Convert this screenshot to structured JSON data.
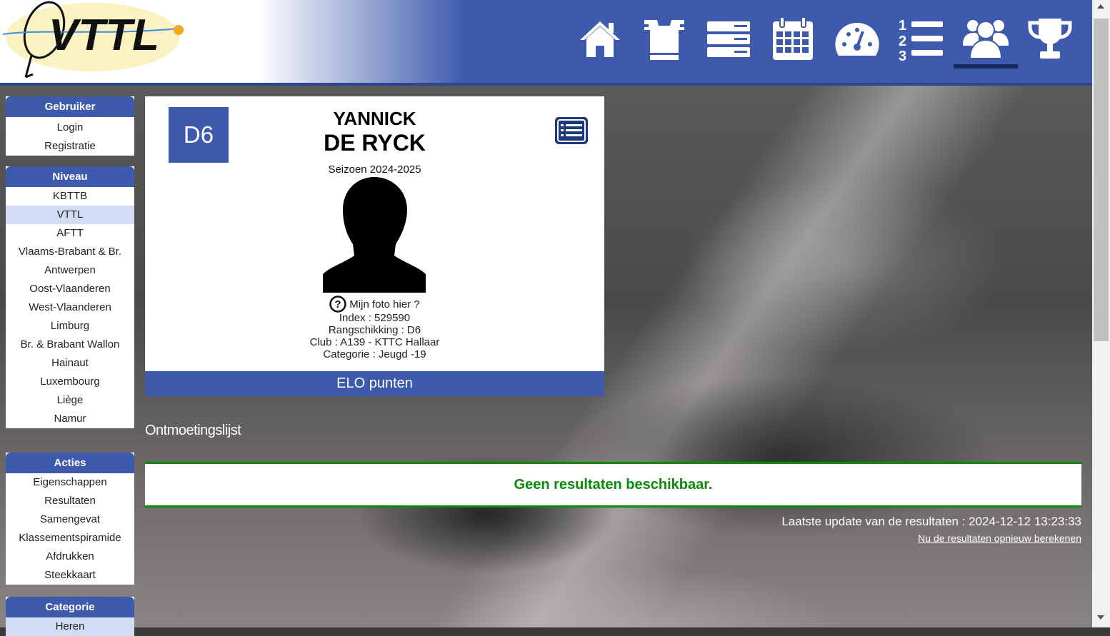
{
  "logo": {
    "text": "VTTL"
  },
  "nav": [
    {
      "icon": "home-icon",
      "active": false
    },
    {
      "icon": "shirt-icon",
      "active": false
    },
    {
      "icon": "divisions-icon",
      "active": false
    },
    {
      "icon": "calendar-icon",
      "active": false
    },
    {
      "icon": "speedometer-icon",
      "active": false
    },
    {
      "icon": "ranking-list-icon",
      "active": false
    },
    {
      "icon": "players-icon",
      "active": true
    },
    {
      "icon": "trophy-icon",
      "active": false
    }
  ],
  "sidebar": {
    "user": {
      "title": "Gebruiker",
      "items": [
        "Login",
        "Registratie"
      ]
    },
    "level": {
      "title": "Niveau",
      "selected": "VTTL",
      "items": [
        "KBTTB",
        "VTTL",
        "AFTT",
        "Vlaams-Brabant & Br.",
        "Antwerpen",
        "Oost-Vlaanderen",
        "West-Vlaanderen",
        "Limburg",
        "Br. & Brabant Wallon",
        "Hainaut",
        "Luxembourg",
        "Liège",
        "Namur"
      ]
    },
    "actions": {
      "title": "Acties",
      "items": [
        "Eigenschappen",
        "Resultaten",
        "Samengevat",
        "Klassementspiramide",
        "Afdrukken",
        "Steekkaart"
      ]
    },
    "category": {
      "title": "Categorie",
      "items": [
        "Heren"
      ]
    }
  },
  "player": {
    "rank_badge": "D6",
    "first_name": "YANNICK",
    "last_name": "DE RYCK",
    "season": "Seizoen 2024-2025",
    "photo_prompt": "Mijn foto hier ?",
    "index": "Index : 529590",
    "ranking": "Rangschikking : D6",
    "club": "Club : A139 - KTTC Hallaar",
    "category": "Categorie : Jeugd -19",
    "elo_label": "ELO punten"
  },
  "results": {
    "section_title": "Ontmoetingslijst",
    "no_results": "Geen resultaten beschikbaar.",
    "last_update": "Laatste update van de resultaten : 2024-12-12 13:23:33",
    "recalc_link": "Nu de resultaten opnieuw berekenen"
  },
  "colors": {
    "brand_blue": "#3d5aad",
    "success_green": "#0a8a0a",
    "selected_bg": "#d2dcf5"
  }
}
